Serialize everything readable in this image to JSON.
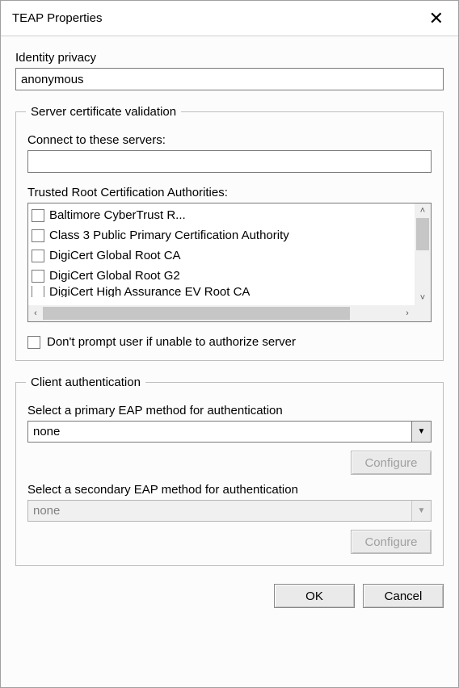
{
  "window": {
    "title": "TEAP Properties"
  },
  "identity": {
    "label": "Identity privacy",
    "value": "anonymous"
  },
  "serverValidation": {
    "legend": "Server certificate validation",
    "connectLabel": "Connect to these servers:",
    "connectValue": "",
    "trustedRootLabel": "Trusted Root Certification Authorities:",
    "authorities": [
      "Baltimore CyberTrust R...",
      "Class 3 Public Primary Certification Authority",
      "DigiCert Global Root CA",
      "DigiCert Global Root G2",
      "DigiCert High Assurance EV Root CA"
    ],
    "dontPromptLabel": "Don't prompt user if unable to authorize server"
  },
  "clientAuth": {
    "legend": "Client authentication",
    "primaryLabel": "Select a primary EAP method for authentication",
    "primaryValue": "none",
    "configureLabel": "Configure",
    "secondaryLabel": "Select a secondary EAP method for authentication",
    "secondaryValue": "none"
  },
  "buttons": {
    "ok": "OK",
    "cancel": "Cancel"
  }
}
